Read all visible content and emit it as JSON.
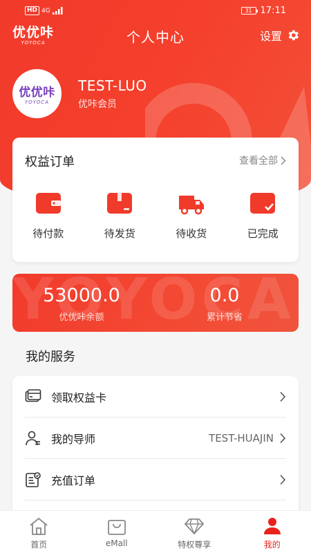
{
  "status_bar": {
    "network": "HD",
    "signal": "4G",
    "battery": "31",
    "time": "17:11"
  },
  "header": {
    "brand_cn": "优优咔",
    "brand_en": "YOYOCA",
    "title": "个人中心",
    "settings_label": "设置"
  },
  "profile": {
    "avatar_cn": "优优咔",
    "avatar_en": "YOYOCA",
    "username": "TEST-LUO",
    "level": "优咔会员"
  },
  "orders": {
    "title": "权益订单",
    "view_all": "查看全部",
    "items": [
      {
        "label": "待付款",
        "icon": "wallet-icon"
      },
      {
        "label": "待发货",
        "icon": "package-icon"
      },
      {
        "label": "待收货",
        "icon": "truck-icon"
      },
      {
        "label": "已完成",
        "icon": "done-icon"
      }
    ]
  },
  "balance": {
    "decoration": "YOYOCA",
    "balance_value": "53000.0",
    "balance_label": "优优咔余额",
    "savings_value": "0.0",
    "savings_label": "累计节省"
  },
  "services": {
    "title": "我的服务",
    "items": [
      {
        "label": "领取权益卡",
        "value": "",
        "icon": "card-icon"
      },
      {
        "label": "我的导师",
        "value": "TEST-HUAJIN",
        "icon": "mentor-icon"
      },
      {
        "label": "充值订单",
        "value": "",
        "icon": "order-list-icon"
      }
    ]
  },
  "tabbar": {
    "items": [
      {
        "label": "首页",
        "icon": "home-icon",
        "active": false
      },
      {
        "label": "eMall",
        "icon": "shopping-bag-icon",
        "active": false
      },
      {
        "label": "特权尊享",
        "icon": "diamond-icon",
        "active": false
      },
      {
        "label": "我的",
        "icon": "user-icon",
        "active": true
      }
    ]
  },
  "colors": {
    "accent": "#f23a2b",
    "active_tab": "#e8231c",
    "background": "#f5f5f5"
  }
}
